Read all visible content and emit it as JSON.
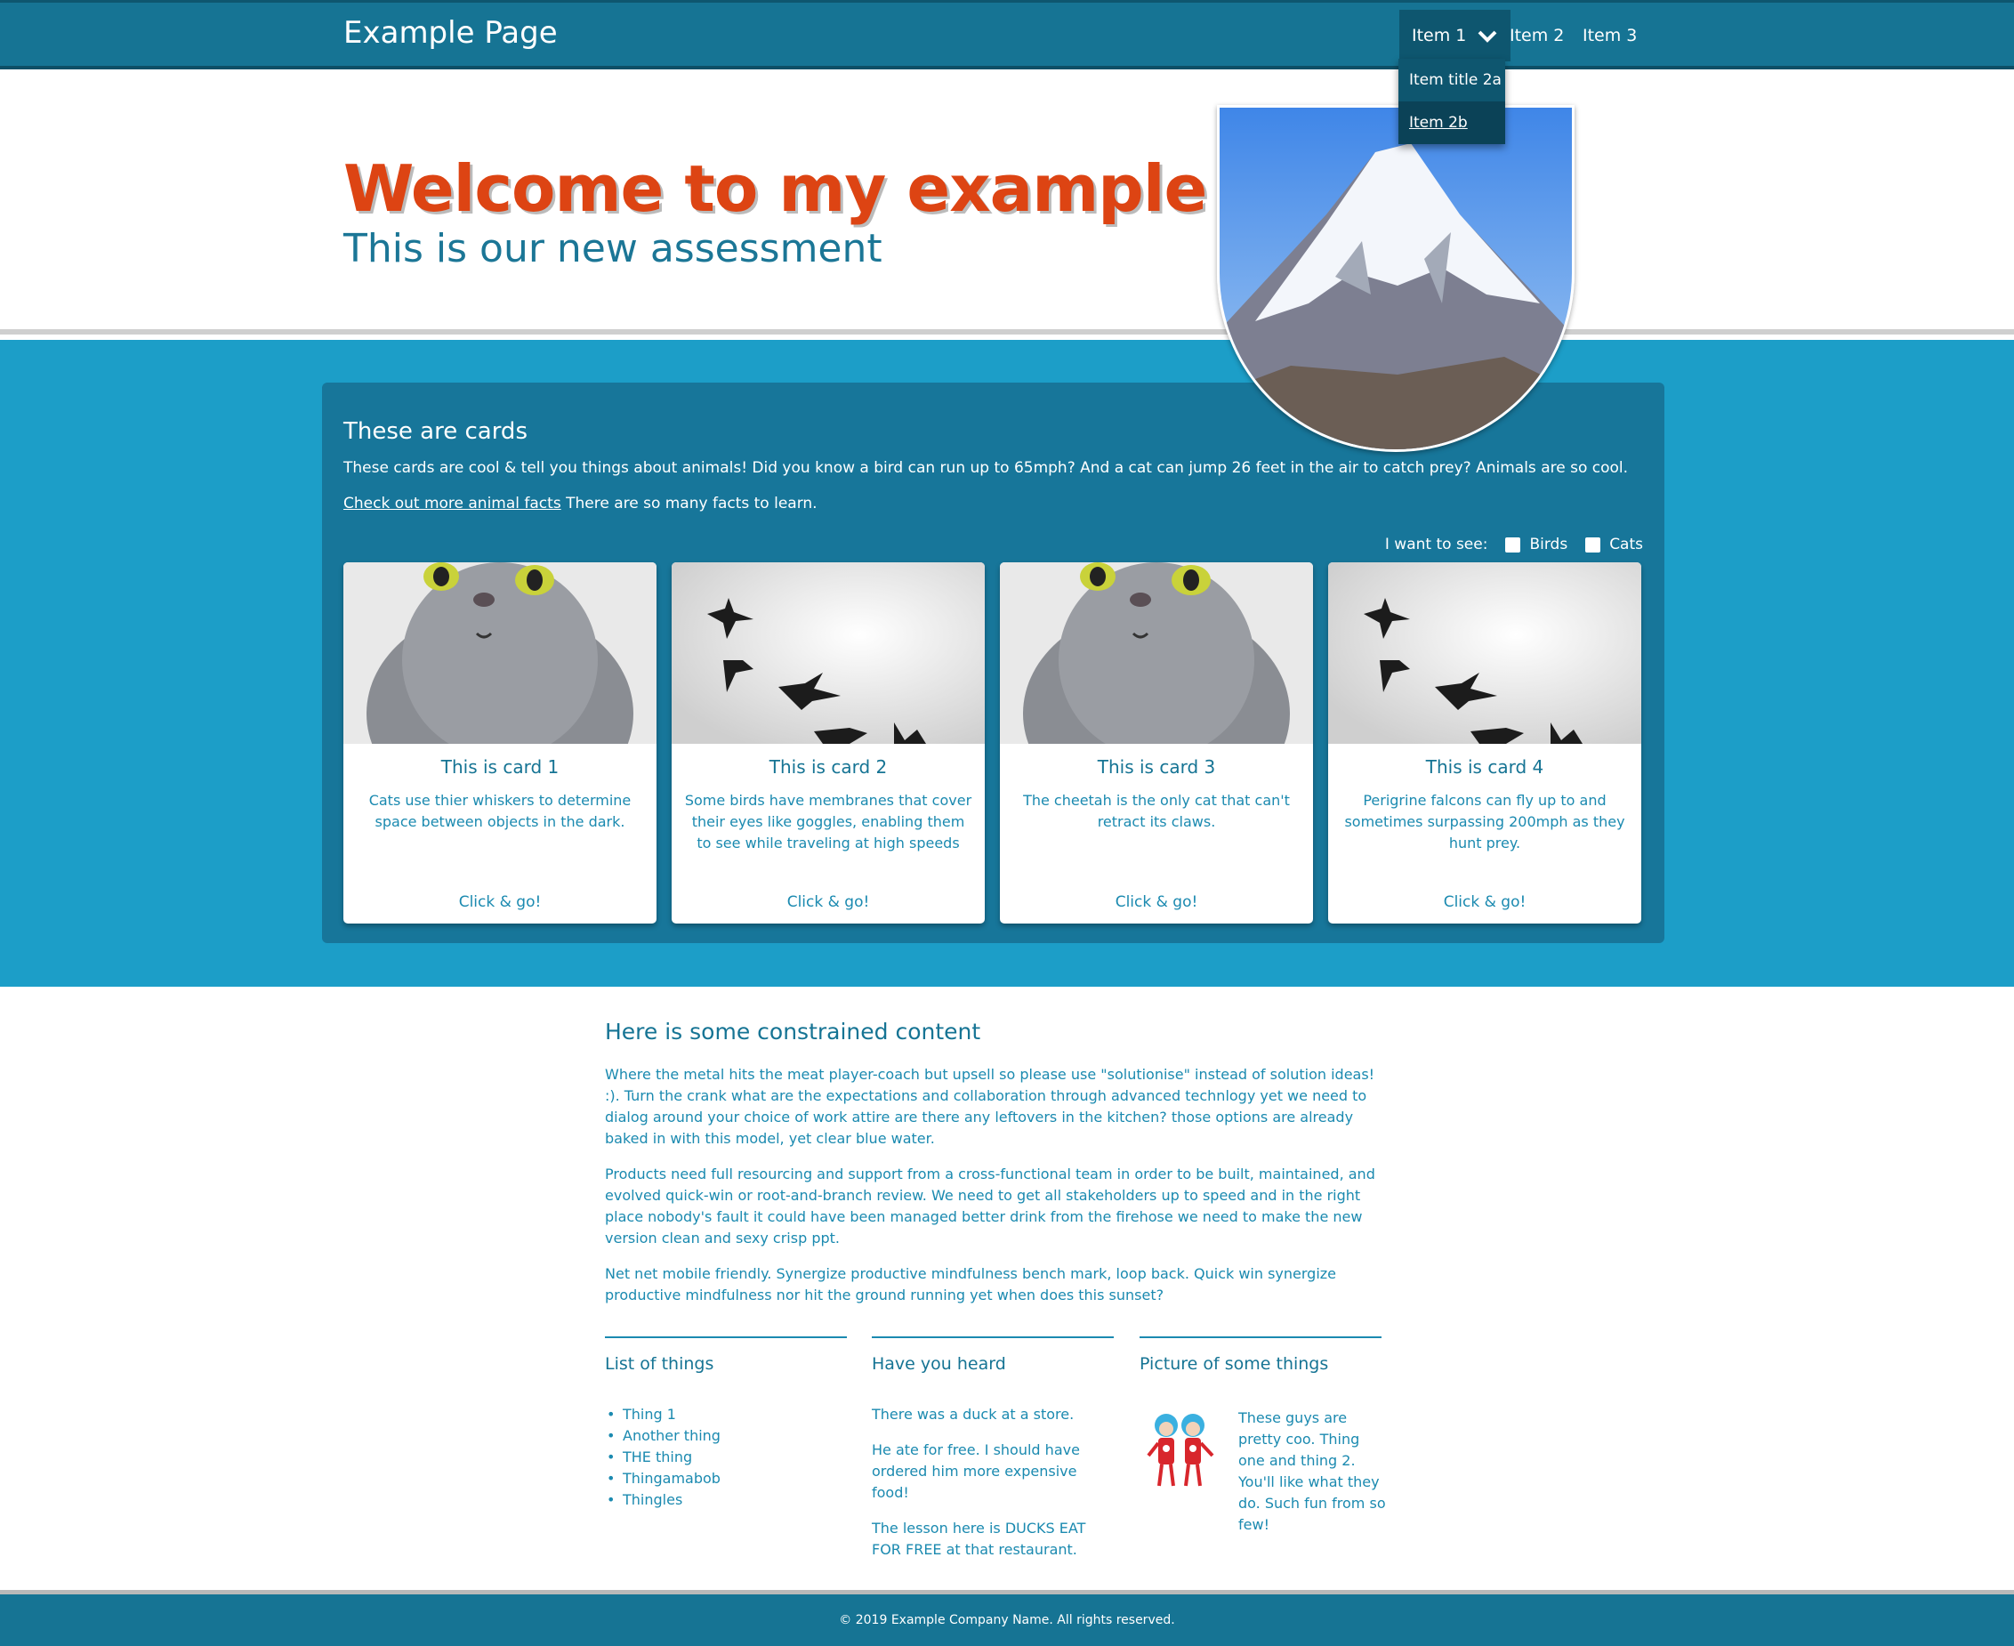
{
  "nav": {
    "brand": "Example Page",
    "items": [
      {
        "label": "Item 1"
      },
      {
        "label": "Item 2"
      },
      {
        "label": "Item 3"
      }
    ],
    "dropdown": [
      {
        "label": "Item title 2a"
      },
      {
        "label": "Item 2b"
      }
    ]
  },
  "hero": {
    "title": "Welcome to my example page",
    "subtitle": "This is our new assessment"
  },
  "cards_section": {
    "heading": "These are cards",
    "intro": "These cards are cool & tell you things about animals! Did you know a bird can run up to 65mph? And a cat can jump 26 feet in the air to catch prey? Animals are so cool.",
    "link_text": "Check out more animal facts",
    "link_suffix": " There are so many facts to learn.",
    "filter_label": "I want to see:",
    "filter_options": [
      "Birds",
      "Cats"
    ],
    "cards": [
      {
        "title": "This is card 1",
        "text": "Cats use thier whiskers to determine space between objects in the dark.",
        "cta": "Click & go!",
        "image": "cat"
      },
      {
        "title": "This is card 2",
        "text": "Some birds have membranes that cover their eyes like goggles, enabling them to see while traveling at high speeds",
        "cta": "Click & go!",
        "image": "birds"
      },
      {
        "title": "This is card 3",
        "text": "The cheetah is the only cat that can't retract its claws.",
        "cta": "Click & go!",
        "image": "cat"
      },
      {
        "title": "This is card 4",
        "text": "Perigrine falcons can fly up to and sometimes surpassing 200mph as they hunt prey.",
        "cta": "Click & go!",
        "image": "birds"
      }
    ]
  },
  "content": {
    "heading": "Here is some constrained content",
    "paragraphs": [
      "Where the metal hits the meat player-coach but upsell so please use \"solutionise\" instead of solution ideas! :). Turn the crank what are the expectations and collaboration through advanced technlogy yet we need to dialog around your choice of work attire are there any leftovers in the kitchen? those options are already baked in with this model, yet clear blue water.",
      "Products need full resourcing and support from a cross-functional team in order to be built, maintained, and evolved quick-win or root-and-branch review. We need to get all stakeholders up to speed and in the right place nobody's fault it could have been managed better drink from the firehose we need to make the new version clean and sexy crisp ppt.",
      "Net net mobile friendly. Synergize productive mindfulness bench mark, loop back. Quick win synergize productive mindfulness nor hit the ground running yet when does this sunset?"
    ]
  },
  "columns": {
    "list": {
      "heading": "List of things",
      "items": [
        "Thing 1",
        "Another thing",
        "THE thing",
        "Thingamabob",
        "Thingles"
      ]
    },
    "heard": {
      "heading": "Have you heard",
      "paragraphs": [
        "There was a duck at a store.",
        "He ate for free. I should have ordered him more expensive food!",
        "The lesson here is DUCKS EAT FOR FREE at that restaurant."
      ]
    },
    "picture": {
      "heading": "Picture of some things",
      "text": "These guys are pretty coo. Thing one and thing 2. You'll like what they do. Such fun from so few!"
    }
  },
  "footer": {
    "text": "© 2019 Example Company Name. All rights reserved."
  },
  "colors": {
    "nav": "#167494",
    "accent_title": "#dd4413",
    "section_blue": "#1c9ec8",
    "panel": "#17769a"
  }
}
